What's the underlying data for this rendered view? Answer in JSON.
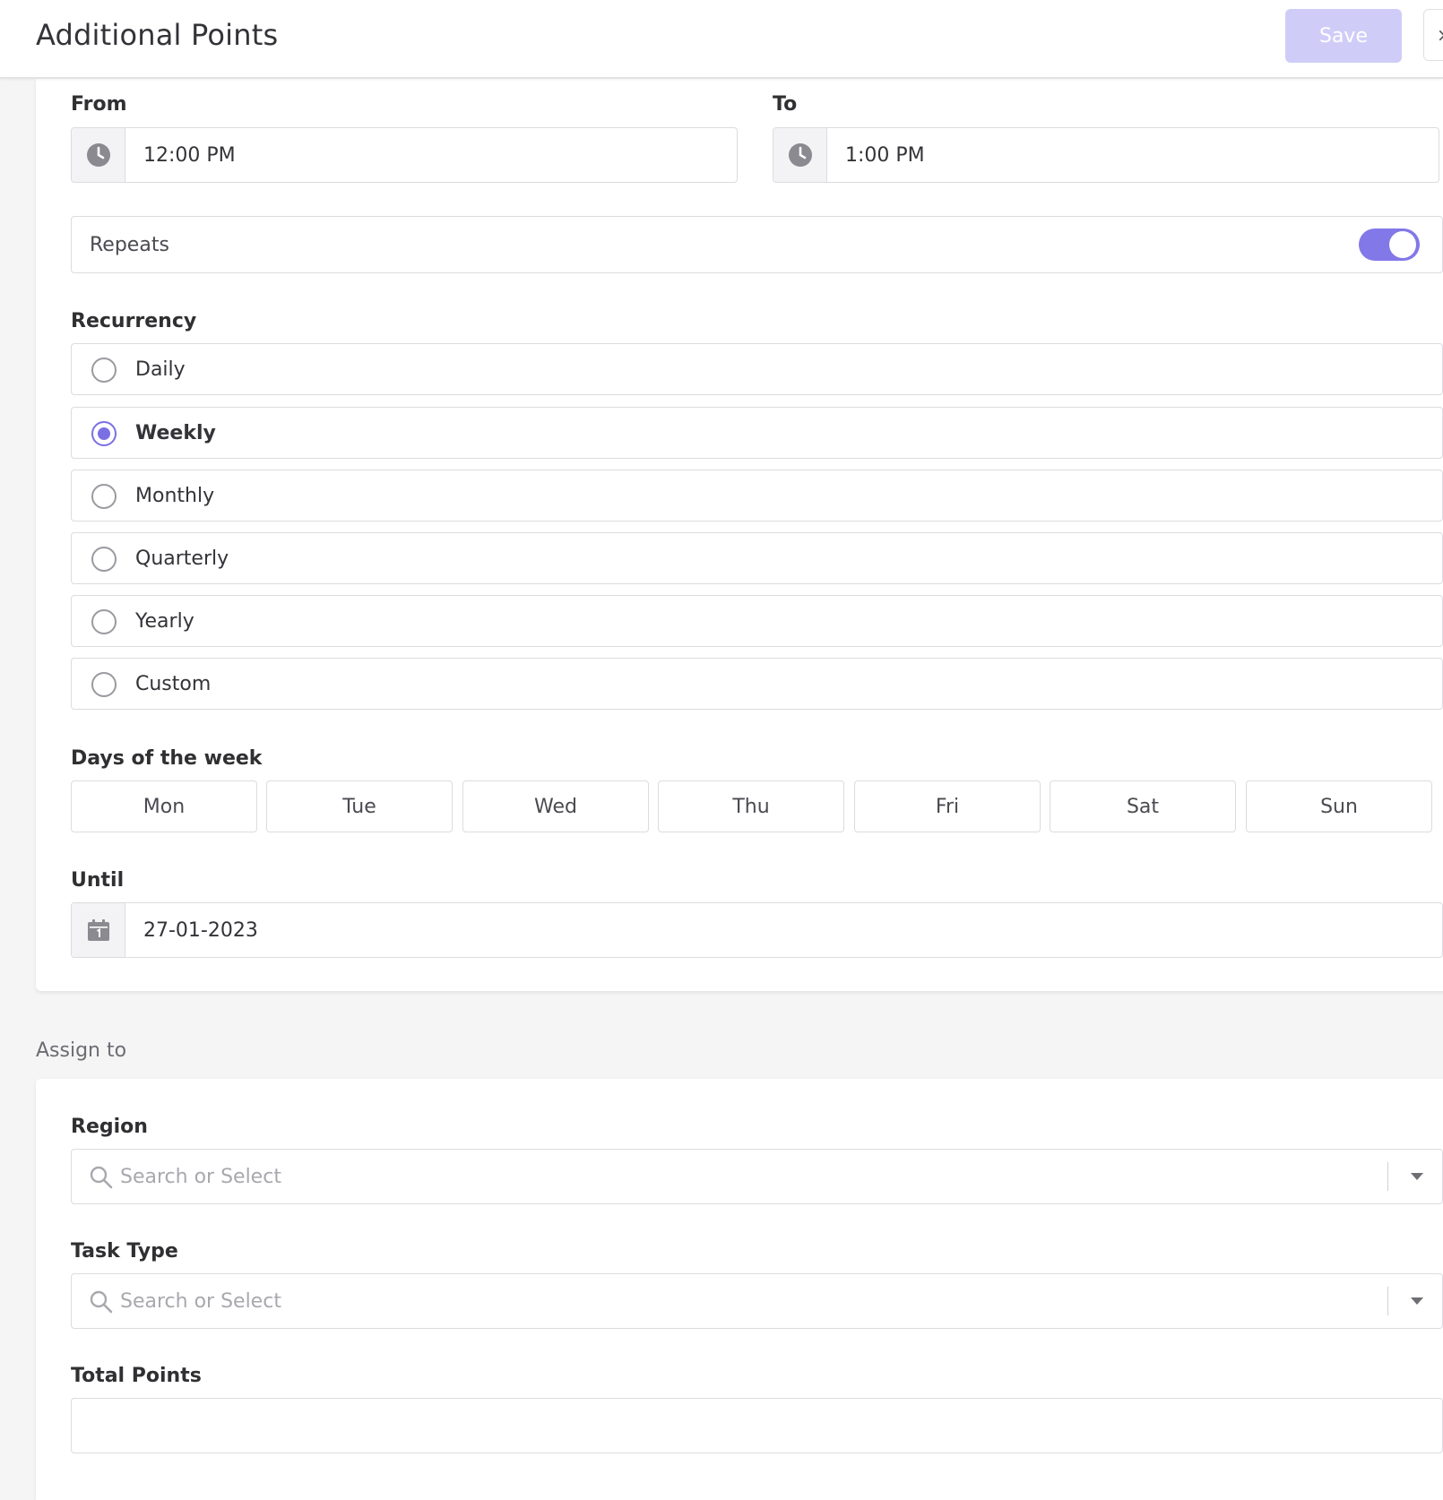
{
  "header": {
    "title": "Additional Points",
    "save_label": "Save",
    "close_glyph": "×"
  },
  "schedule": {
    "from_label": "From",
    "from_value": "12:00 PM",
    "to_label": "To",
    "to_value": "1:00 PM",
    "repeats_label": "Repeats",
    "repeats_on": true,
    "recurrency_label": "Recurrency",
    "recurrency_options": [
      {
        "label": "Daily",
        "selected": false
      },
      {
        "label": "Weekly",
        "selected": true
      },
      {
        "label": "Monthly",
        "selected": false
      },
      {
        "label": "Quarterly",
        "selected": false
      },
      {
        "label": "Yearly",
        "selected": false
      },
      {
        "label": "Custom",
        "selected": false
      }
    ],
    "days_label": "Days of the week",
    "days": [
      "Mon",
      "Tue",
      "Wed",
      "Thu",
      "Fri",
      "Sat",
      "Sun"
    ],
    "until_label": "Until",
    "until_value": "27-01-2023"
  },
  "assign": {
    "section_label": "Assign to",
    "region_label": "Region",
    "region_placeholder": "Search or Select",
    "task_type_label": "Task Type",
    "task_type_placeholder": "Search or Select",
    "total_points_label": "Total Points",
    "total_points_value": ""
  },
  "colors": {
    "accent": "#7b70e3",
    "save_disabled": "#cfcdf8",
    "background": "#f5f5f6"
  }
}
